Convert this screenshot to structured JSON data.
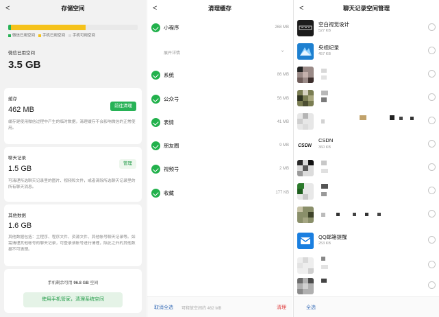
{
  "storage_panel": {
    "title": "存储空间",
    "legend": {
      "wechat": "微信已用空间",
      "phone": "手机已用空间",
      "free": "手机可用空间"
    },
    "usage_fraction": {
      "wechat": 0.02,
      "phone": 0.58,
      "free": 0.4
    },
    "colors": {
      "wechat": "#27b256",
      "phone": "#f5c21b",
      "free": "#e9e9e9"
    },
    "used_label": "微信已用空间",
    "used_size": "3.5 GB",
    "cache": {
      "title": "缓存",
      "size": "462 MB",
      "button": "前往清理",
      "desc": "缓存是使用微信过程中产生的临时数据，清理缓存不会影响微信的正常使用。"
    },
    "chat": {
      "title": "聊天记录",
      "size": "1.5 GB",
      "button": "管理",
      "desc": "可清理所选聊天记录里的图片、视频和文件，或者清除所选聊天记录里的所有聊天消息。"
    },
    "other": {
      "title": "其他数据",
      "size": "1.6 GB",
      "desc": "其他数据包括：主程序、程序文件、资源文件、其他帐号聊天记录等。如需清理其他帐号的聊天记录，可登录该帐号进行清理，除此之外的其他数据不可清理。"
    },
    "remain_prefix": "手机剩余可用",
    "remain_value": "96.8 GB",
    "remain_suffix": "空间",
    "phone_manager_button": "使用手机管家，清理系统空间"
  },
  "cache_panel": {
    "title": "清理缓存",
    "expand_label": "展开详情",
    "items": [
      {
        "label": "小程序",
        "size": "268 MB"
      },
      {
        "label": "系统",
        "size": "86 MB"
      },
      {
        "label": "公众号",
        "size": "56 MB"
      },
      {
        "label": "表情",
        "size": "41 MB"
      },
      {
        "label": "朋友圈",
        "size": "9 MB"
      },
      {
        "label": "视频号",
        "size": "2 MB"
      },
      {
        "label": "收藏",
        "size": "177 KB"
      }
    ],
    "footer": {
      "deselect": "取消全选",
      "releasable": "可释放空间约 462 MB",
      "clean": "清理"
    }
  },
  "chat_panel": {
    "title": "聊天记录空间管理",
    "chats": [
      {
        "name": "空白视觉设计",
        "size": "527 KB",
        "icon": "zinc-logo-icon"
      },
      {
        "name": "央视纪录",
        "size": "457 KB",
        "icon": "cctv-logo-icon"
      },
      {
        "name": "",
        "size": "",
        "icon": "blurred-avatar-icon"
      },
      {
        "name": "",
        "size": "",
        "icon": "blurred-avatar-icon"
      },
      {
        "name": "",
        "size": "",
        "icon": "blurred-avatar-icon"
      },
      {
        "name": "CSDN",
        "size": "360 KB",
        "icon": "csdn-logo-icon"
      },
      {
        "name": "",
        "size": "",
        "icon": "blurred-avatar-icon"
      },
      {
        "name": "",
        "size": "",
        "icon": "blurred-avatar-icon"
      },
      {
        "name": "",
        "size": "",
        "icon": "blurred-avatar-icon"
      },
      {
        "name": "QQ邮箱提醒",
        "size": "253 KB",
        "icon": "mail-icon"
      },
      {
        "name": "",
        "size": "",
        "icon": "blurred-avatar-icon"
      },
      {
        "name": "",
        "size": "",
        "icon": "blurred-avatar-icon"
      }
    ],
    "footer": {
      "select_all": "全选"
    }
  }
}
